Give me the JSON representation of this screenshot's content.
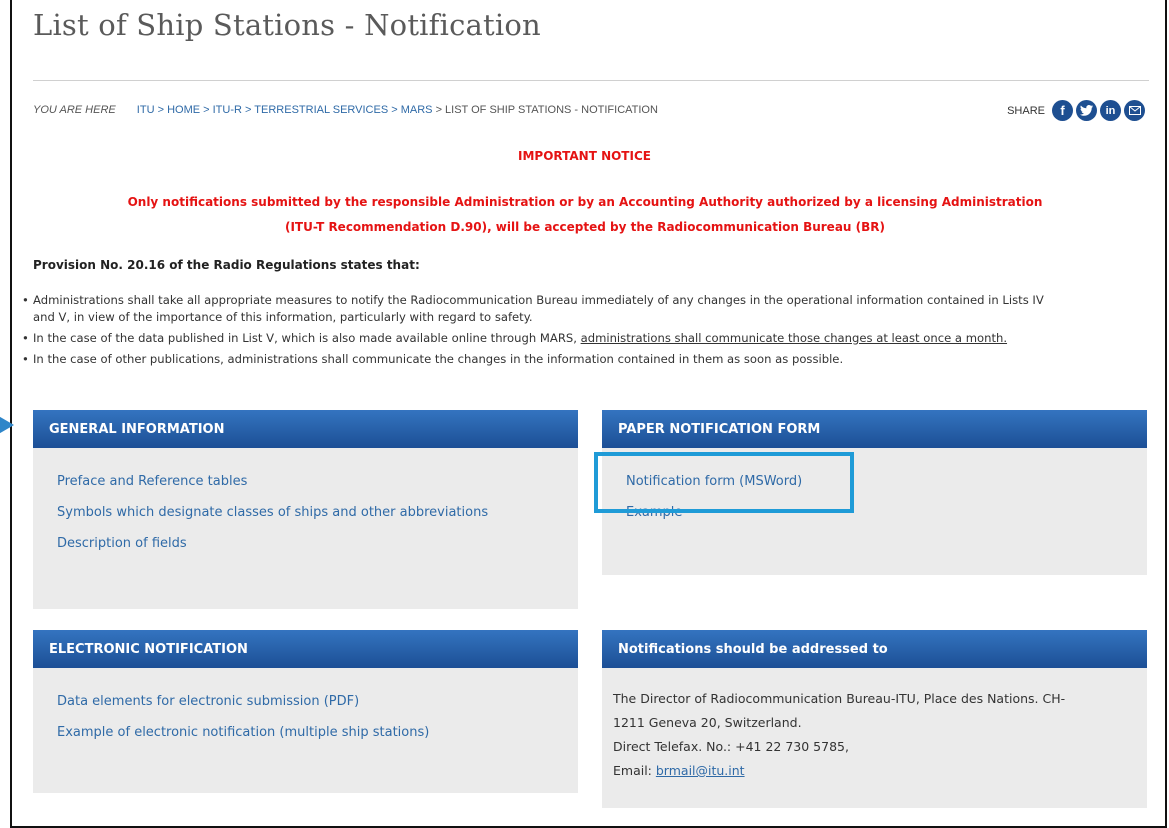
{
  "page": {
    "title": "List of Ship Stations - Notification"
  },
  "breadcrumb": {
    "prefix": "YOU ARE HERE",
    "items": [
      "ITU",
      "> HOME",
      "> ITU-R",
      "> TERRESTRIAL SERVICES",
      "> MARS",
      "> LIST OF SHIP STATIONS - NOTIFICATION"
    ]
  },
  "share": {
    "label": "SHARE",
    "icons": [
      "facebook-icon",
      "twitter-icon",
      "linkedin-icon",
      "email-icon"
    ]
  },
  "notice": {
    "title": "IMPORTANT NOTICE",
    "line1": "Only notifications submitted by the responsible Administration or by an Accounting Authority authorized by a licensing Administration",
    "line2": "(ITU-T Recommendation D.90), will be accepted by the Radiocommunication Bureau (BR)"
  },
  "provision": {
    "heading": "Provision No. 20.16 of the Radio Regulations states that:",
    "bullet1_line1": "Administrations shall take all appropriate measures to notify the Radiocommunication Bureau immediately of any changes in the operational information contained in Lists IV",
    "bullet1_line2": "and V, in view of the importance of this information, particularly with regard to safety.",
    "bullet2_pre": "In the case of the data published in List V, which is also made available online through MARS, ",
    "bullet2_link": "administrations shall communicate those changes at least once a month.",
    "bullet3": "In the case of other publications, administrations shall communicate the changes in the information contained in them as soon as possible."
  },
  "general_info": {
    "title": "GENERAL INFORMATION",
    "links": [
      "Preface and Reference tables",
      "Symbols which designate classes of ships and other abbreviations",
      "Description of fields"
    ]
  },
  "paper_form": {
    "title": "PAPER NOTIFICATION FORM",
    "links": [
      "Notification form (MSWord)",
      "Example"
    ]
  },
  "electronic": {
    "title": "ELECTRONIC NOTIFICATION",
    "links": [
      "Data elements for electronic submission (PDF)",
      "Example of electronic notification (multiple ship stations)"
    ]
  },
  "address": {
    "title": "Notifications should be addressed to",
    "line1": "The Director of Radiocommunication Bureau-ITU, Place des Nations. CH-",
    "line2": "1211 Geneva 20, Switzerland.",
    "line3": "Direct Telefax. No.: +41 22 730 5785,",
    "email_label": "Email: ",
    "email": "brmail@itu.int"
  },
  "colors": {
    "header_blue": "#1c4f95",
    "link_blue": "#2f6aa7",
    "notice_red": "#e51313",
    "highlight": "#1f9bd7",
    "panel_bg": "#ebebeb"
  }
}
